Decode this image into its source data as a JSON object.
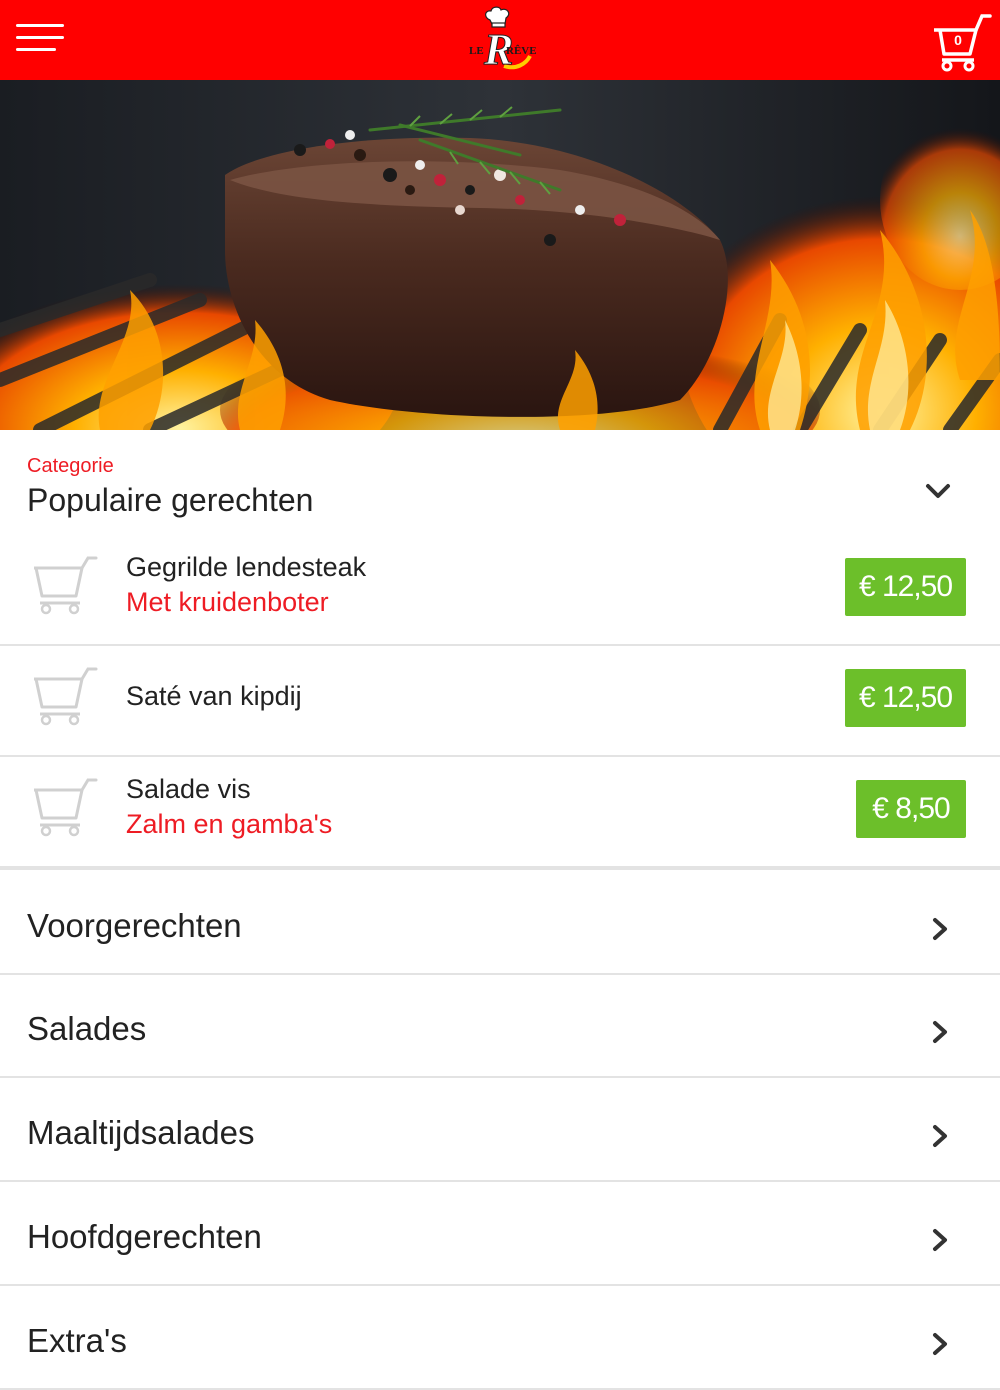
{
  "header": {
    "menu_icon": "hamburger-icon",
    "logo_text_left": "LE",
    "logo_initial": "R",
    "logo_text_right": "RÊVE",
    "cart_icon": "shopping-cart-icon",
    "cart_count": "0",
    "background_color": "#ff0000"
  },
  "hero": {
    "subject": "grilled steak on flaming grill"
  },
  "category": {
    "label": "Categorie",
    "title": "Populaire gerechten",
    "toggle_icon": "chevron-down-icon"
  },
  "popular_dishes": [
    {
      "name": "Gegrilde lendesteak",
      "description": "Met kruidenboter",
      "price": "€ 12,50"
    },
    {
      "name": "Saté van kipdij",
      "description": "",
      "price": "€ 12,50"
    },
    {
      "name": "Salade vis",
      "description": "Zalm en gamba's",
      "price": "€ 8,50"
    }
  ],
  "categories": [
    {
      "label": "Voorgerechten"
    },
    {
      "label": "Salades"
    },
    {
      "label": "Maaltijdsalades"
    },
    {
      "label": "Hoofdgerechten"
    },
    {
      "label": "Extra's"
    }
  ],
  "colors": {
    "accent": "#ee1c24",
    "price_badge": "#6cbf2a",
    "text": "#222222",
    "divider": "#e3e3e3"
  }
}
